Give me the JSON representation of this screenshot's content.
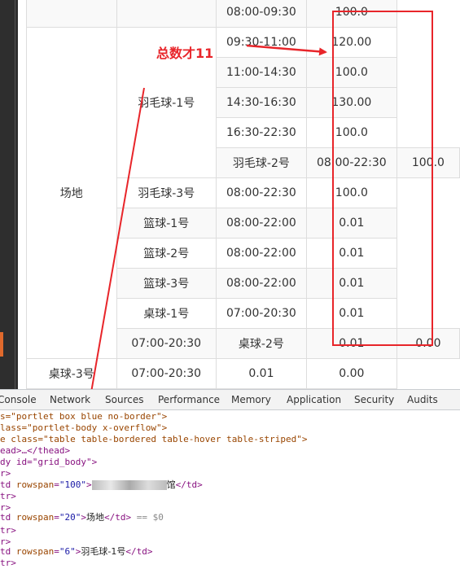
{
  "table": {
    "venue_label": "场地",
    "rows": [
      {
        "venue": "",
        "court": "",
        "time": "08:00-09:30",
        "price": "100.0"
      },
      {
        "venue": "",
        "court": "羽毛球-1号",
        "time": "09:30-11:00",
        "price": "120.00"
      },
      {
        "venue": "",
        "court": "",
        "time": "11:00-14:30",
        "price": "100.0"
      },
      {
        "venue": "",
        "court": "",
        "time": "14:30-16:30",
        "price": "130.00"
      },
      {
        "venue": "",
        "court": "",
        "time": "16:30-22:30",
        "price": "100.0"
      },
      {
        "venue": "",
        "court": "羽毛球-2号",
        "time": "08:00-22:30",
        "price": "100.0"
      },
      {
        "venue": "",
        "court": "羽毛球-3号",
        "time": "08:00-22:30",
        "price": "100.0"
      },
      {
        "venue": "",
        "court": "篮球-1号",
        "time": "08:00-22:00",
        "price": "0.01"
      },
      {
        "venue": "",
        "court": "篮球-2号",
        "time": "08:00-22:00",
        "price": "0.01"
      },
      {
        "venue": "",
        "court": "篮球-3号",
        "time": "08:00-22:00",
        "price": "0.01"
      },
      {
        "venue": "",
        "court": "桌球-1号",
        "time": "07:00-20:30",
        "price": "0.01"
      }
    ],
    "extra_rows": [
      {
        "a": "07:00-20:30",
        "b": "桌球-2号",
        "c": "0.01",
        "d": "0.00"
      },
      {
        "a": "桌球-3号",
        "b": "07:00-20:30",
        "c": "0.01",
        "d": "0.00"
      }
    ]
  },
  "annotation": {
    "text": "总数才11",
    "color": "#e8252a"
  },
  "devtools": {
    "tabs": [
      "Console",
      "Network",
      "Sources",
      "Performance",
      "Memory",
      "Application",
      "Security",
      "Audits"
    ],
    "lines": {
      "l1_cls": "s=\"portlet box blue no-border\">",
      "l2_cls": "lass=\"portlet-body x-overflow\">",
      "l3_cls": "e class=\"table table-bordered table-hover table-striped\">",
      "l4": "ead>…</thead>",
      "l5": "dy id=\"grid_body\">",
      "l6": "r>",
      "l7_attr": "rowspan",
      "l7_val": "\"100\"",
      "l7_end": "馆",
      "l8": "tr>",
      "l9": "r>",
      "l10_attr": "rowspan",
      "l10_val": "\"20\"",
      "l10_text": "场地",
      "l10_sel": "== $0",
      "l11": "tr>",
      "l12": "r>",
      "l13_attr": "rowspan",
      "l13_val": "\"6\"",
      "l13_text": "羽毛球-1号",
      "l14": "tr>"
    }
  }
}
